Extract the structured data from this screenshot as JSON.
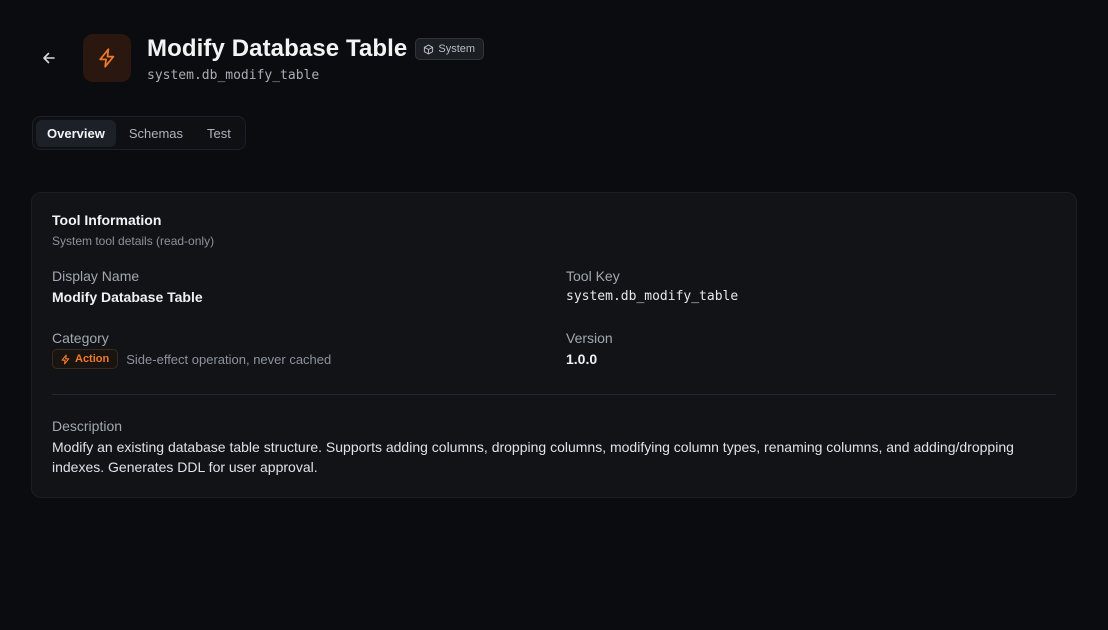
{
  "header": {
    "title": "Modify Database Table",
    "badge_label": "System",
    "tool_key": "system.db_modify_table",
    "icons": {
      "back": "arrow-left-icon",
      "tool": "lightning-bolt-icon",
      "badge": "cube-icon"
    },
    "accent_color": "#f07a2c"
  },
  "tabs": [
    {
      "label": "Overview",
      "active": true
    },
    {
      "label": "Schemas",
      "active": false
    },
    {
      "label": "Test",
      "active": false
    }
  ],
  "card": {
    "title": "Tool Information",
    "subtitle": "System tool details (read-only)",
    "display_name": {
      "label": "Display Name",
      "value": "Modify Database Table"
    },
    "tool_key": {
      "label": "Tool Key",
      "value": "system.db_modify_table"
    },
    "category": {
      "label": "Category",
      "badge": "Action",
      "note": "Side-effect operation, never cached"
    },
    "version": {
      "label": "Version",
      "value": "1.0.0"
    },
    "description": {
      "label": "Description",
      "value": "Modify an existing database table structure. Supports adding columns, dropping columns, modifying column types, renaming columns, and adding/dropping indexes. Generates DDL for user approval."
    }
  }
}
